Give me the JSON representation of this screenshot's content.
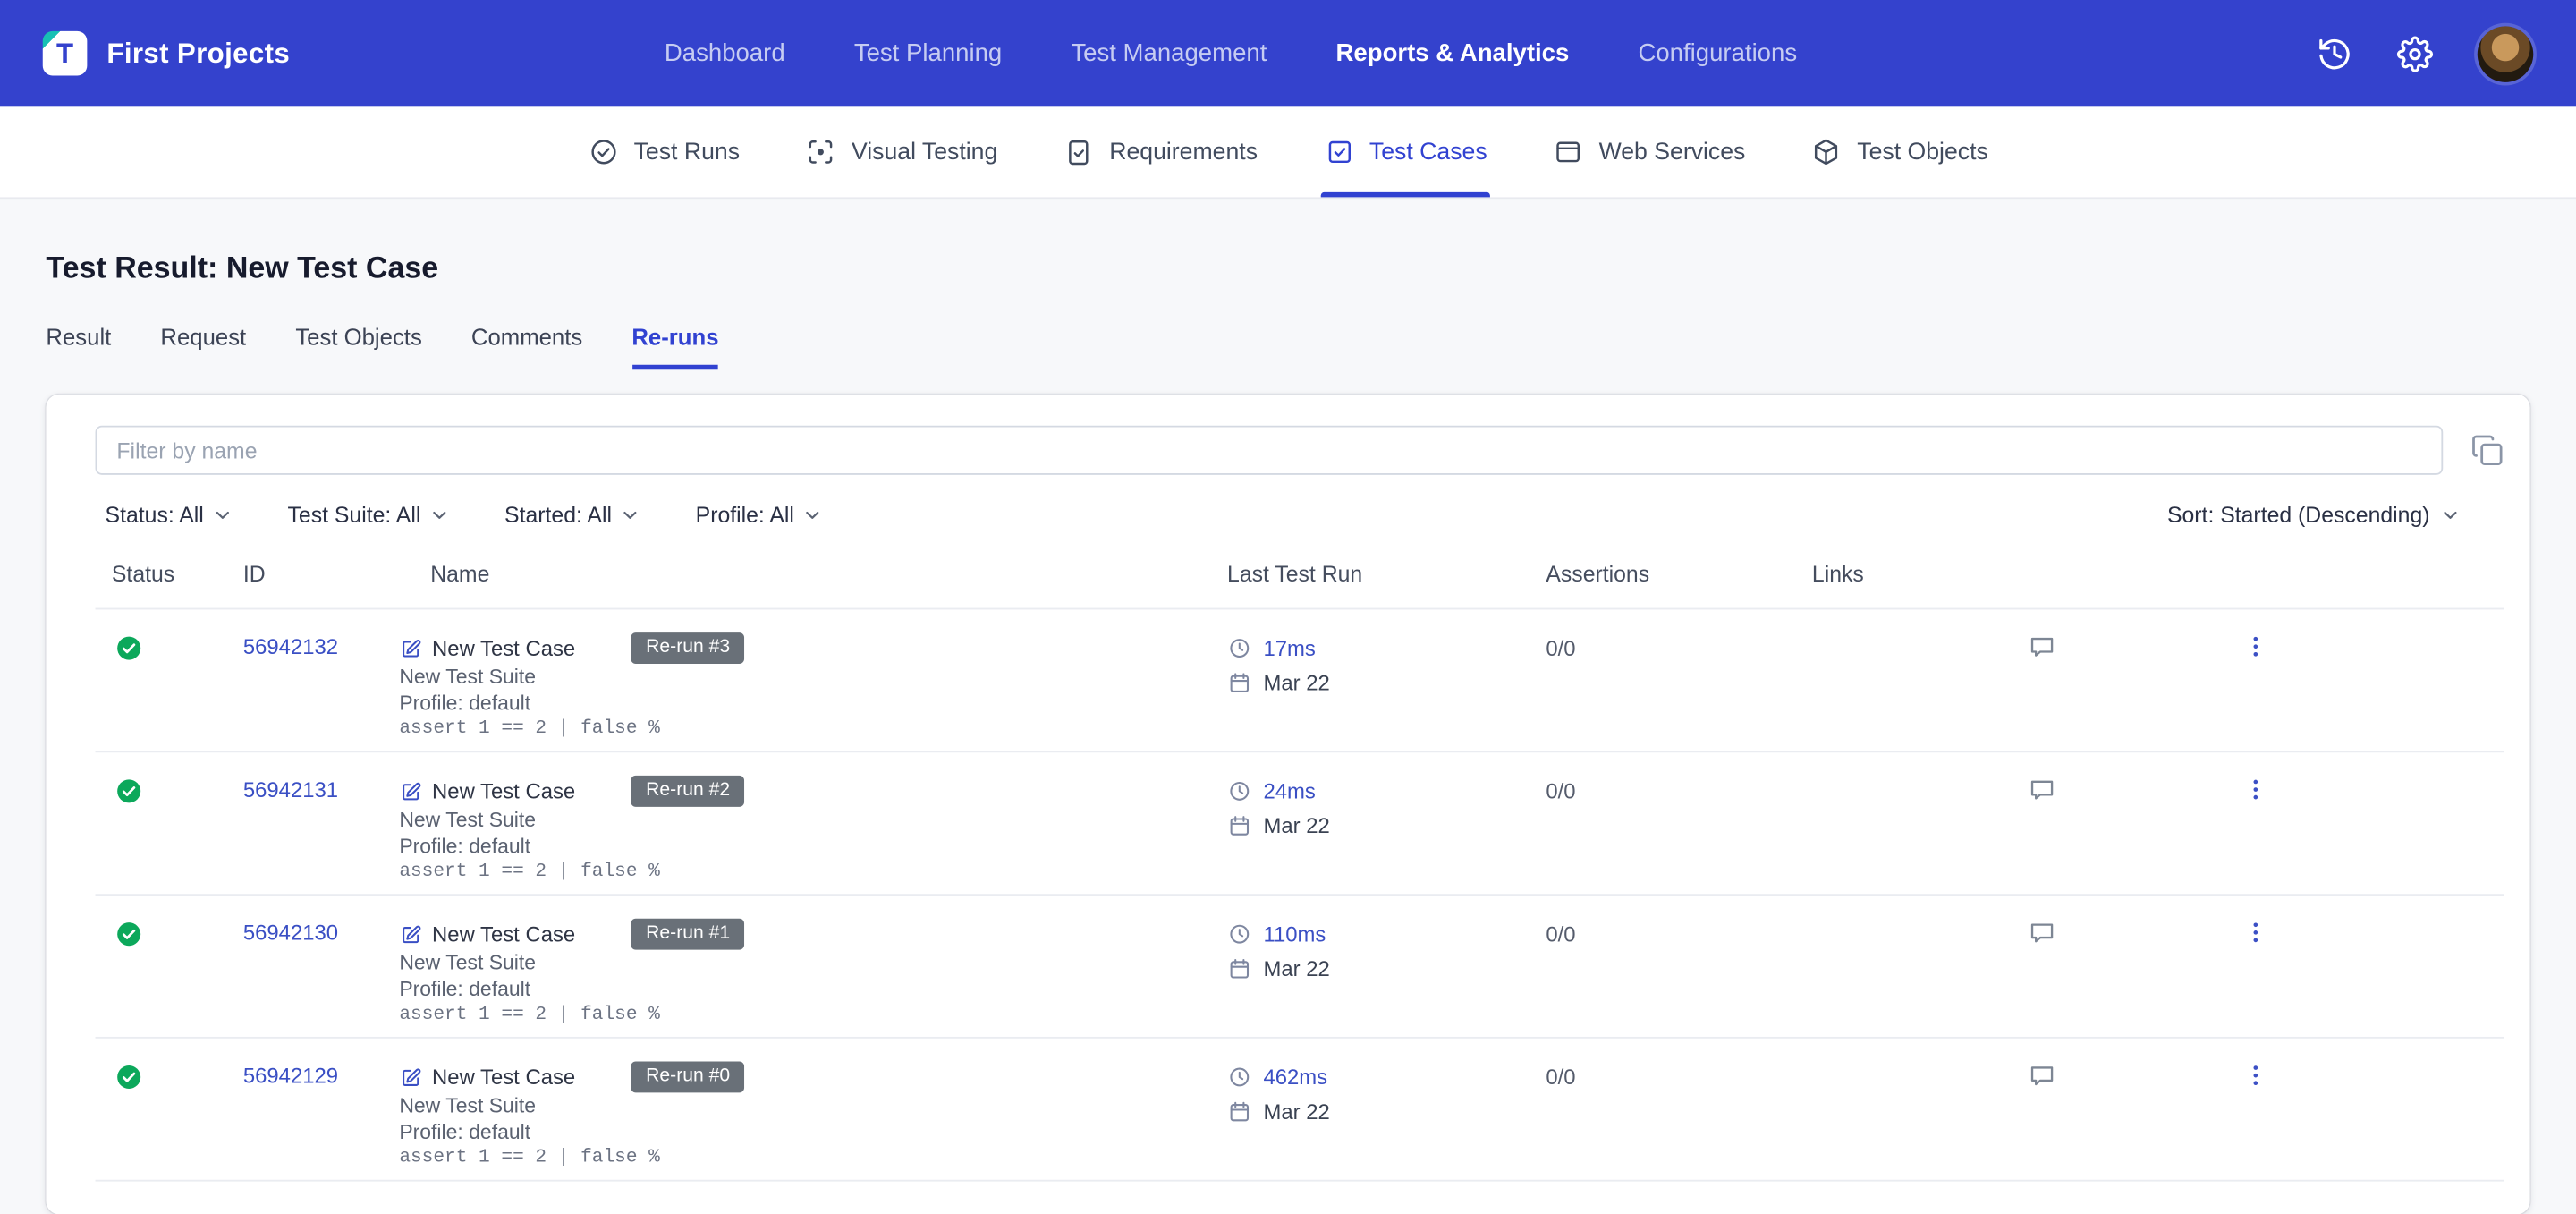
{
  "colors": {
    "primary": "#3442CD",
    "link": "#3A4FC4",
    "success": "#0CA85B",
    "badge_bg": "#697078",
    "page_bg": "#F7F8FA"
  },
  "navbar": {
    "logo_letter": "T",
    "project_name": "First Projects",
    "items": [
      {
        "label": "Dashboard"
      },
      {
        "label": "Test Planning"
      },
      {
        "label": "Test Management"
      },
      {
        "label": "Reports & Analytics",
        "active": true
      },
      {
        "label": "Configurations"
      }
    ]
  },
  "subnav": {
    "items": [
      {
        "label": "Test Runs"
      },
      {
        "label": "Visual Testing"
      },
      {
        "label": "Requirements"
      },
      {
        "label": "Test Cases",
        "active": true
      },
      {
        "label": "Web Services"
      },
      {
        "label": "Test Objects"
      }
    ]
  },
  "page": {
    "title": "Test Result: New Test Case",
    "tabs": [
      {
        "label": "Result"
      },
      {
        "label": "Request"
      },
      {
        "label": "Test Objects"
      },
      {
        "label": "Comments"
      },
      {
        "label": "Re-runs",
        "active": true
      }
    ]
  },
  "filters": {
    "search_placeholder": "Filter by name",
    "dropdowns": [
      {
        "label": "Status: All"
      },
      {
        "label": "Test Suite: All"
      },
      {
        "label": "Started: All"
      },
      {
        "label": "Profile: All"
      }
    ],
    "sort_label": "Sort: Started (Descending)"
  },
  "table": {
    "columns": [
      "Status",
      "ID",
      "Name",
      "Last Test Run",
      "Assertions",
      "Links"
    ],
    "rows": [
      {
        "status": "passed",
        "id": "56942132",
        "name": "New Test Case",
        "rerun_badge": "Re-run #3",
        "suite": "New Test Suite",
        "profile": "Profile: default",
        "assertion": "assert 1 == 2 | false %",
        "duration": "17ms",
        "date": "Mar 22",
        "assertions": "0/0"
      },
      {
        "status": "passed",
        "id": "56942131",
        "name": "New Test Case",
        "rerun_badge": "Re-run #2",
        "suite": "New Test Suite",
        "profile": "Profile: default",
        "assertion": "assert 1 == 2 | false %",
        "duration": "24ms",
        "date": "Mar 22",
        "assertions": "0/0"
      },
      {
        "status": "passed",
        "id": "56942130",
        "name": "New Test Case",
        "rerun_badge": "Re-run #1",
        "suite": "New Test Suite",
        "profile": "Profile: default",
        "assertion": "assert 1 == 2 | false %",
        "duration": "110ms",
        "date": "Mar 22",
        "assertions": "0/0"
      },
      {
        "status": "passed",
        "id": "56942129",
        "name": "New Test Case",
        "rerun_badge": "Re-run #0",
        "suite": "New Test Suite",
        "profile": "Profile: default",
        "assertion": "assert 1 == 2 | false %",
        "duration": "462ms",
        "date": "Mar 22",
        "assertions": "0/0"
      }
    ]
  }
}
